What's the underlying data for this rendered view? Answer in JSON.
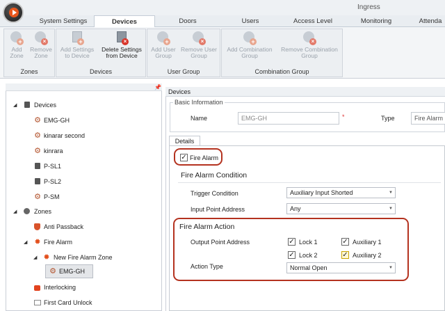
{
  "app": {
    "title": "Ingress"
  },
  "tabs": [
    {
      "label": "System Settings",
      "active": false
    },
    {
      "label": "Devices",
      "active": true
    },
    {
      "label": "Doors",
      "active": false
    },
    {
      "label": "Users",
      "active": false
    },
    {
      "label": "Access Level",
      "active": false
    },
    {
      "label": "Monitoring",
      "active": false
    },
    {
      "label": "Attenda",
      "active": false
    }
  ],
  "ribbon": {
    "zones": {
      "label": "Zones",
      "add": "Add\nZone",
      "remove": "Remove\nZone"
    },
    "devices": {
      "label": "Devices",
      "add": "Add Settings\nto Device",
      "delete": "Delete Settings\nfrom Device"
    },
    "usergroup": {
      "label": "User Group",
      "add": "Add User\nGroup",
      "remove": "Remove User\nGroup"
    },
    "combination": {
      "label": "Combination Group",
      "add": "Add Combination\nGroup",
      "remove": "Remove Combination\nGroup"
    }
  },
  "tree": {
    "devices": "Devices",
    "device_items": [
      "EMG-GH",
      "kinarar second",
      "kinrara",
      "P-SL1",
      "P-SL2",
      "P-SM"
    ],
    "zones": "Zones",
    "anti_passback": "Anti Passback",
    "fire_alarm": "Fire Alarm",
    "new_fire_zone": "New Fire Alarm Zone",
    "selected_device": "EMG-GH",
    "interlocking": "Interlocking",
    "first_card": "First Card Unlock"
  },
  "panel": {
    "header": "Devices",
    "basic_info": "Basic Information",
    "name_label": "Name",
    "name_value": "EMG-GH",
    "required_mark": "*",
    "type_label": "Type",
    "type_value": "Fire Alarm",
    "details_tab": "Details",
    "fire_alarm_cb": "Fire Alarm",
    "condition_title": "Fire Alarm Condition",
    "trigger_label": "Trigger Condition",
    "trigger_value": "Auxiliary Input Shorted",
    "input_label": "Input Point Address",
    "input_value": "Any",
    "action_title": "Fire Alarm Action",
    "output_label": "Output Point Address",
    "lock1": "Lock 1",
    "aux1": "Auxiliary 1",
    "lock2": "Lock 2",
    "aux2": "Auxiliary 2",
    "action_type_label": "Action Type",
    "action_type_value": "Normal Open"
  },
  "icons": {
    "pin": "pin-icon",
    "dropdown": "chevron-down-icon"
  }
}
